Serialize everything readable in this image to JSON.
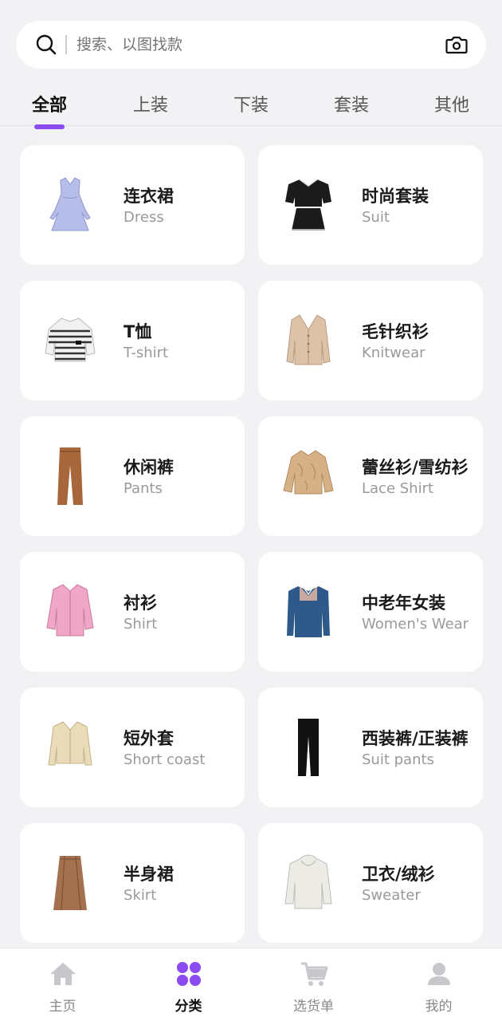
{
  "search": {
    "placeholder": "搜索、以图找款"
  },
  "tabs": [
    "全部",
    "上装",
    "下装",
    "套装",
    "其他"
  ],
  "active_tab": "全部",
  "categories": [
    {
      "zh": "连衣裙",
      "en": "Dress",
      "icon": "dress-icon"
    },
    {
      "zh": "时尚套装",
      "en": "Suit",
      "icon": "suit-set-icon"
    },
    {
      "zh": "T恤",
      "en": "T-shirt",
      "icon": "tshirt-icon"
    },
    {
      "zh": "毛针织衫",
      "en": "Knitwear",
      "icon": "cardigan-icon"
    },
    {
      "zh": "休闲裤",
      "en": "Pants",
      "icon": "pants-icon"
    },
    {
      "zh": "蕾丝衫/雪纺衫",
      "en": "Lace Shirt",
      "icon": "lace-blouse-icon"
    },
    {
      "zh": "衬衫",
      "en": "Shirt",
      "icon": "shirt-icon"
    },
    {
      "zh": "中老年女装",
      "en": "Women's Wear",
      "icon": "polo-sweater-icon"
    },
    {
      "zh": "短外套",
      "en": "Short coast",
      "icon": "short-jacket-icon"
    },
    {
      "zh": "西装裤/正装裤",
      "en": "Suit pants",
      "icon": "black-trousers-icon"
    },
    {
      "zh": "半身裙",
      "en": "Skirt",
      "icon": "skirt-icon"
    },
    {
      "zh": "卫衣/绒衫",
      "en": "Sweater",
      "icon": "hoodie-icon"
    }
  ],
  "bottom_nav": [
    {
      "label": "主页",
      "icon": "home-icon"
    },
    {
      "label": "分类",
      "icon": "category-icon"
    },
    {
      "label": "选货单",
      "icon": "cart-icon"
    },
    {
      "label": "我的",
      "icon": "profile-icon"
    }
  ],
  "active_nav": "分类",
  "colors": {
    "accent": "#8a4cf0",
    "inactive_icon": "#c8c8cc",
    "background": "#f2f2f4"
  }
}
